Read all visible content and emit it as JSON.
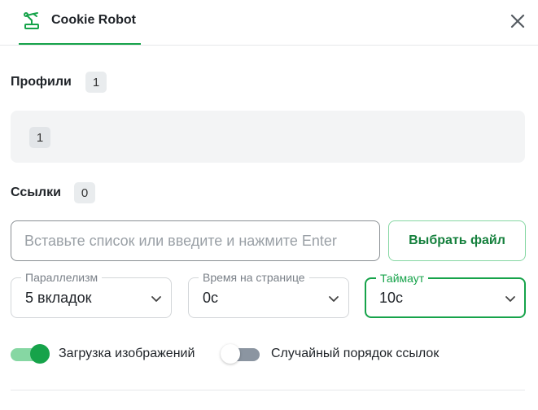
{
  "header": {
    "tab_title": "Cookie Robot",
    "tab_icon": "robot-arm-icon",
    "close_icon": "close-icon",
    "accent_color": "#16a34a"
  },
  "profiles": {
    "label": "Профили",
    "count": "1",
    "items": [
      "1"
    ]
  },
  "links": {
    "label": "Ссылки",
    "count": "0",
    "input_placeholder": "Вставьте список или введите и нажмите Enter",
    "input_value": "",
    "file_button_label": "Выбрать файл"
  },
  "settings": {
    "parallelism": {
      "label": "Параллелизм",
      "value": "5 вкладок"
    },
    "page_time": {
      "label": "Время на странице",
      "value": "0с"
    },
    "timeout": {
      "label": "Таймаут",
      "value": "10с"
    }
  },
  "toggles": {
    "images": {
      "label": "Загрузка изображений",
      "on": true
    },
    "random_order": {
      "label": "Случайный порядок ссылок",
      "on": false
    }
  }
}
